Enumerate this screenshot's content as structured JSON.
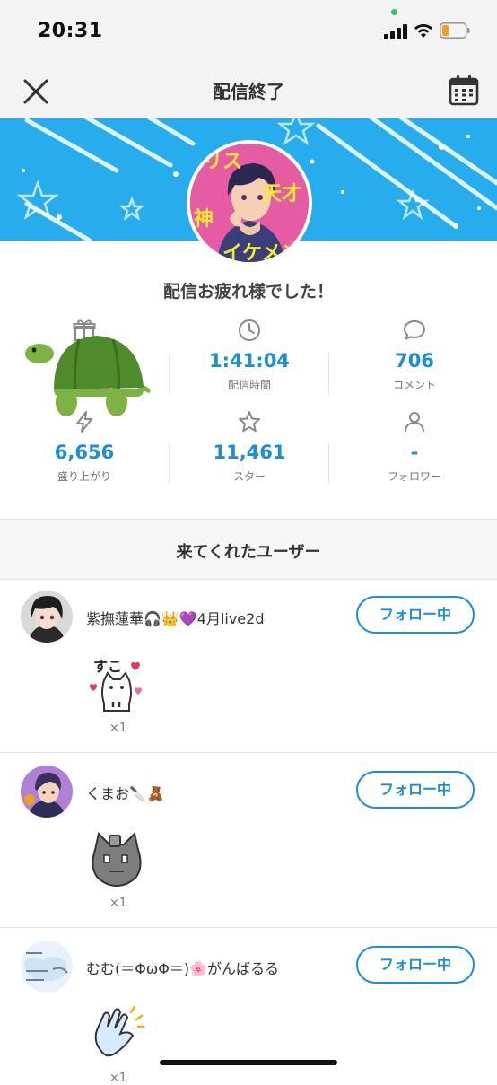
{
  "status": {
    "time": "20:31"
  },
  "nav": {
    "title": "配信終了"
  },
  "banner": {
    "avatar_text": [
      "リス",
      "天才",
      "神",
      "イケメン"
    ]
  },
  "headline": "配信お疲れ様でした！",
  "stats": [
    {
      "value": "",
      "label": ""
    },
    {
      "value": "1:41:04",
      "label": "配信時間"
    },
    {
      "value": "706",
      "label": "コメント"
    },
    {
      "value": "6,656",
      "label": "盛り上がり"
    },
    {
      "value": "11,461",
      "label": "スター"
    },
    {
      "value": "-",
      "label": "フォロワー"
    }
  ],
  "section": {
    "title": "来てくれたユーザー"
  },
  "users": [
    {
      "name": "紫撫蓮華🎧👑💜4月live2d",
      "follow_label": "フォロー中",
      "gift_count": "×1"
    },
    {
      "name": "くまお🔪🧸",
      "follow_label": "フォロー中",
      "gift_count": "×1"
    },
    {
      "name": "むむ(＝ΦωΦ＝)🌸がんばるる",
      "follow_label": "フォロー中",
      "gift_count": "×1"
    }
  ],
  "gift_texts": {
    "suko": "すこ"
  },
  "colors": {
    "accent": "#1a8fd6",
    "banner": "#27adee",
    "turtle_shell": "#4f8a2b",
    "turtle_skin": "#7cb342"
  }
}
